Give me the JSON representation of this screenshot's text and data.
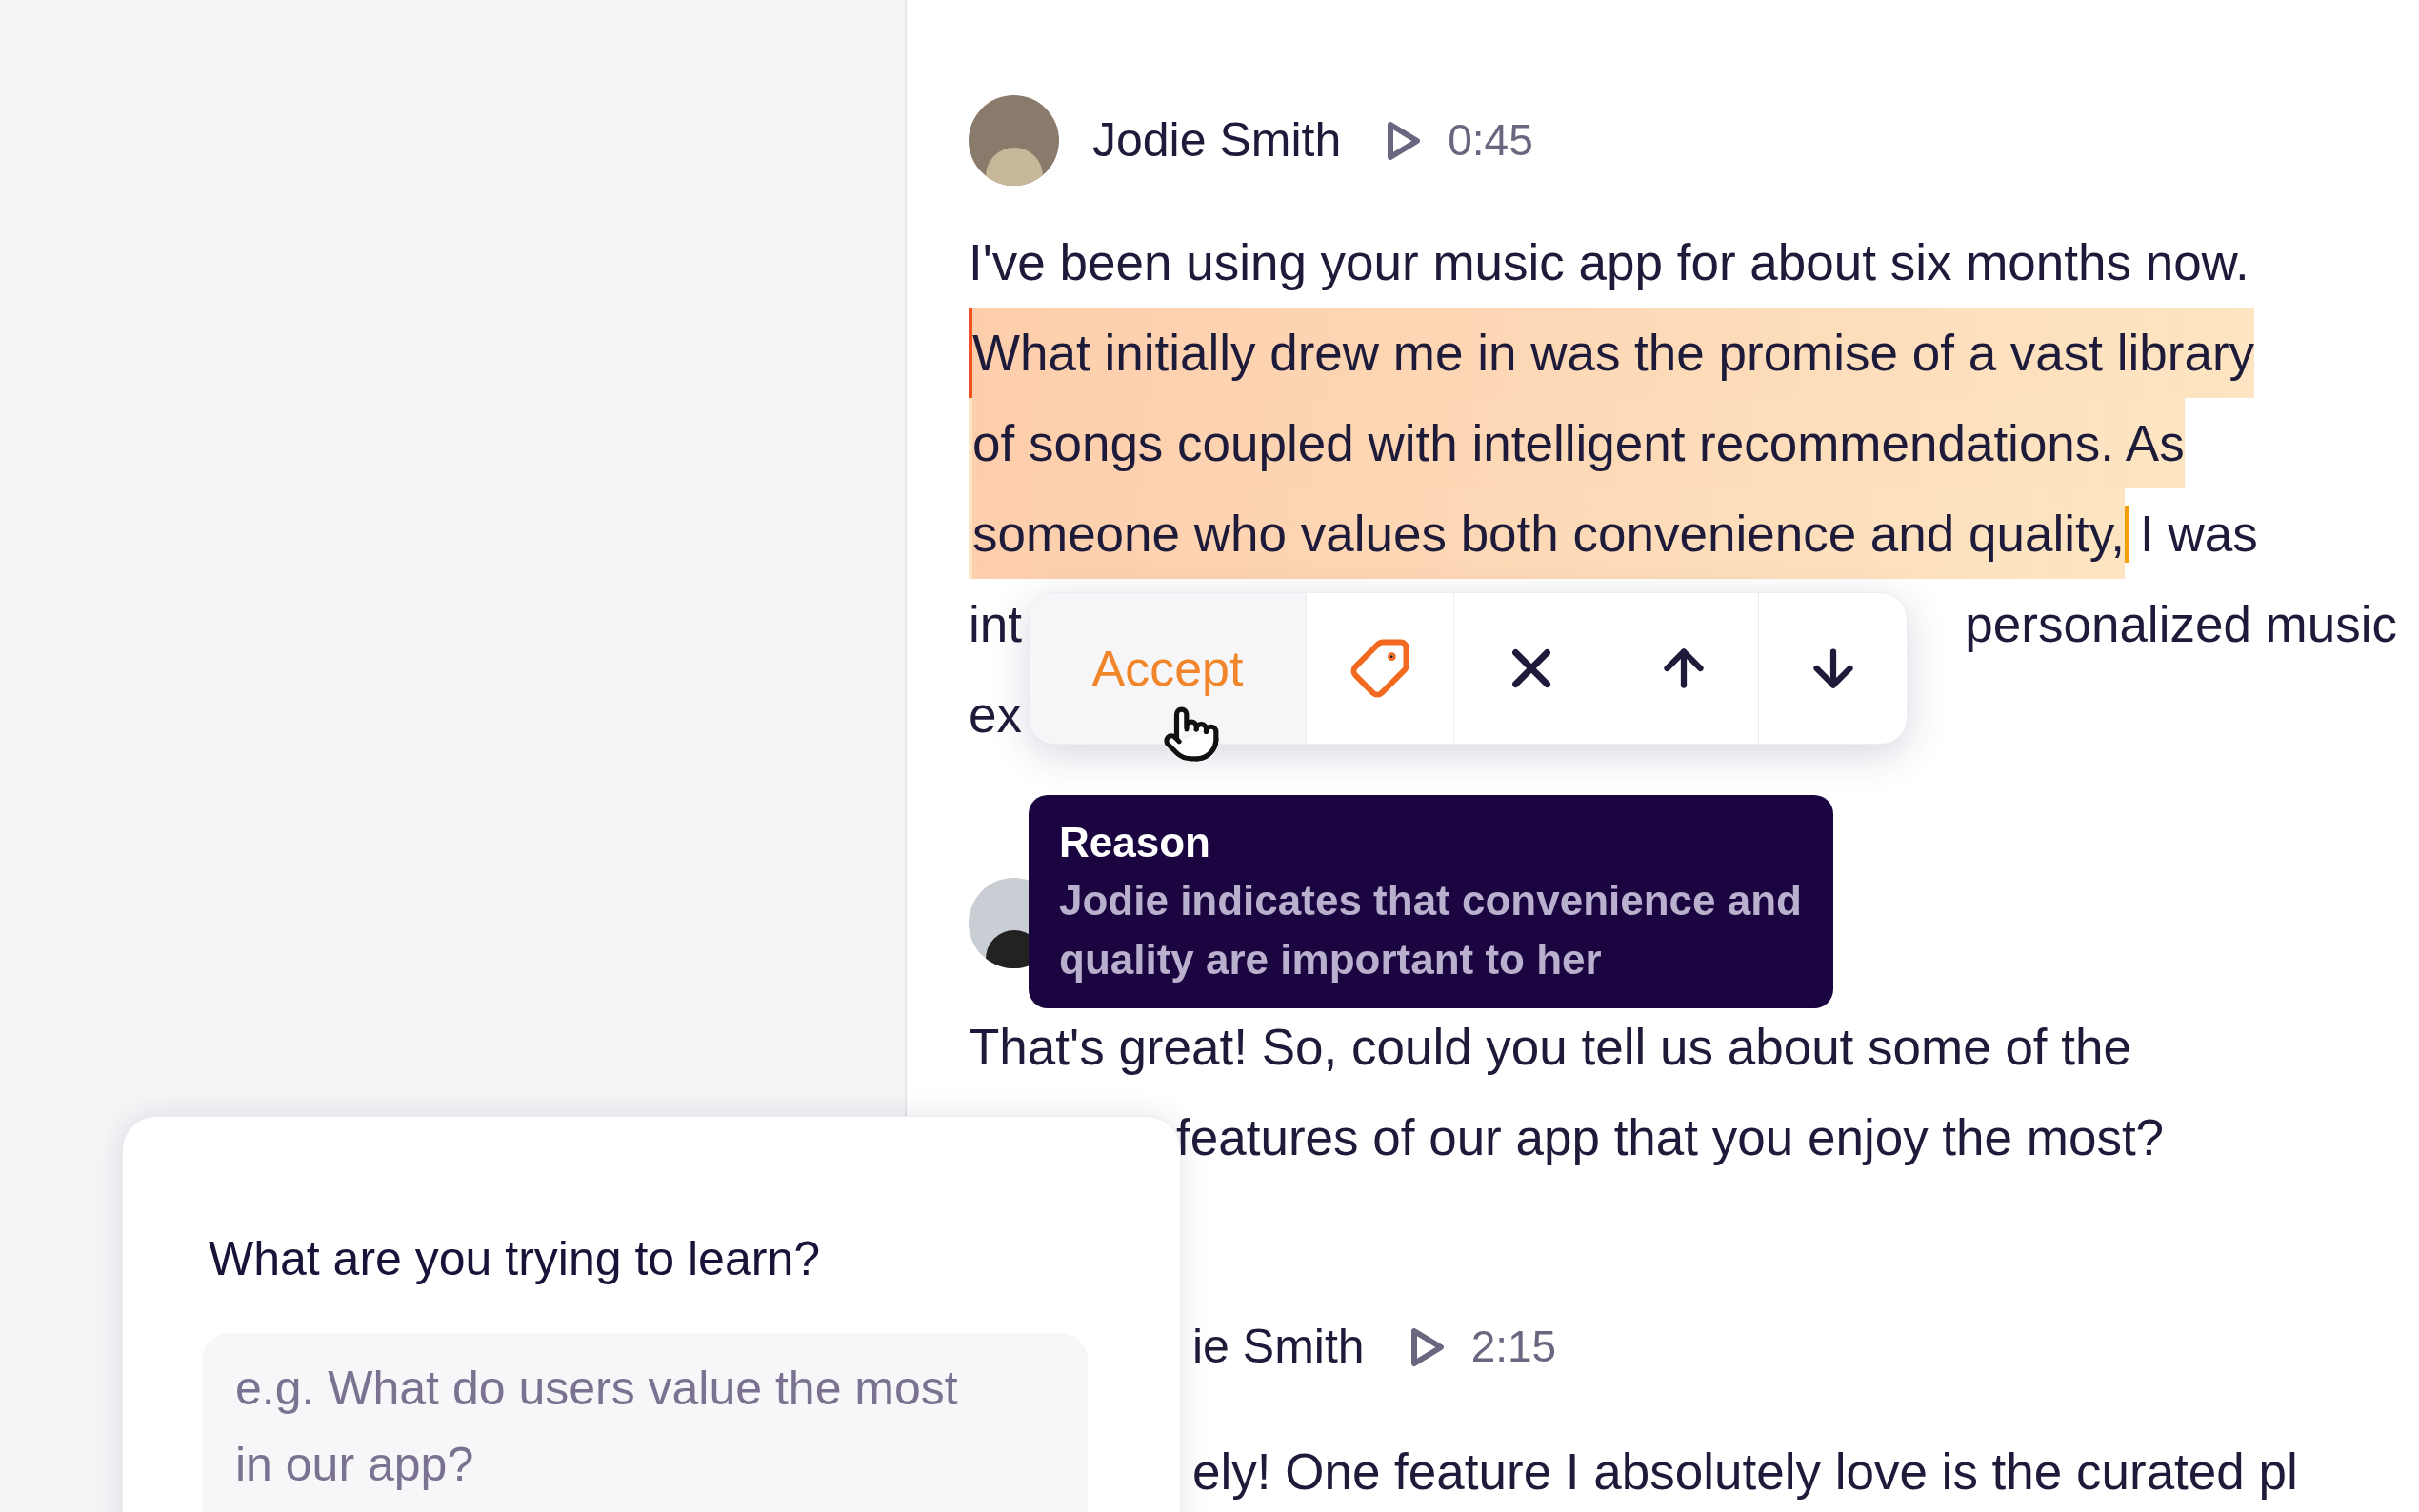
{
  "messages": [
    {
      "kind": "highlighted",
      "speaker": "Jodie Smith",
      "timestamp": "0:45",
      "text": "I've been using your music app for about six months now.",
      "highlight_lines": [
        "What initially drew me in was the promise of a vast library",
        "of songs coupled with intelligent recommendations. As",
        "someone who values both convenience and quality,"
      ],
      "text_after": "I was",
      "covered_lines": [
        {
          "left": "int",
          "right": "personalized music"
        },
        {
          "left": "ex"
        }
      ]
    },
    {
      "kind": "avatar_only",
      "lines": [
        "That's great! So, could you tell us about some of the",
        "features of our app that you enjoy the most?"
      ]
    },
    {
      "kind": "name_only",
      "speaker": "ie Smith",
      "timestamp": "2:15",
      "lines": [
        "ely! One feature I absolutely love is the curated pl"
      ]
    }
  ],
  "highlight_toolbar": {
    "accept_label": "Accept"
  },
  "tooltip": {
    "title": "Reason",
    "text": "Jodie indicates that convenience and quality are important to her"
  },
  "learn_card": {
    "question": "What are you trying to learn?",
    "placeholder": "e.g. What do users value the most in our app?"
  }
}
